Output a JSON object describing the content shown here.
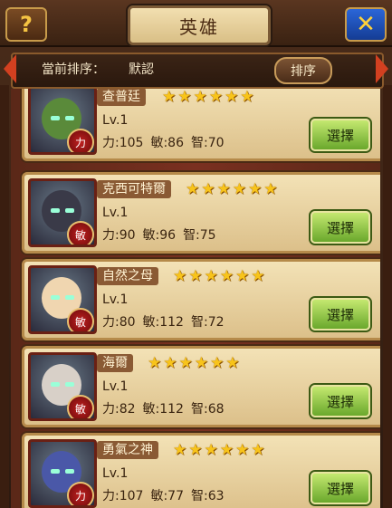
{
  "header": {
    "title": "英雄",
    "help_icon_glyph": "?",
    "close_icon_glyph": "✕"
  },
  "sort": {
    "label": "當前排序：",
    "value": "默認",
    "button_label": "排序"
  },
  "heroes": [
    {
      "name": "查普廷",
      "stars": 6,
      "level": "Lv.1",
      "str": "力:105",
      "agi": "敏:86",
      "int": "智:70",
      "attr": "力",
      "select": "選擇",
      "face_color": "#5a8a3a"
    },
    {
      "name": "克西可特爾",
      "stars": 6,
      "level": "Lv.1",
      "str": "力:90",
      "agi": "敏:96",
      "int": "智:75",
      "attr": "敏",
      "select": "選擇",
      "face_color": "#3a3a48"
    },
    {
      "name": "自然之母",
      "stars": 6,
      "level": "Lv.1",
      "str": "力:80",
      "agi": "敏:112",
      "int": "智:72",
      "attr": "敏",
      "select": "選擇",
      "face_color": "#f0d6b0"
    },
    {
      "name": "海爾",
      "stars": 6,
      "level": "Lv.1",
      "str": "力:82",
      "agi": "敏:112",
      "int": "智:68",
      "attr": "敏",
      "select": "選擇",
      "face_color": "#d8d0c8"
    },
    {
      "name": "勇氣之神",
      "stars": 6,
      "level": "Lv.1",
      "str": "力:107",
      "agi": "敏:77",
      "int": "智:63",
      "attr": "力",
      "select": "選擇",
      "face_color": "#4a58a8"
    }
  ],
  "colors": {
    "accent_red": "#d24020",
    "select_green": "#6aa82c",
    "star_gold": "#f8c41a"
  }
}
